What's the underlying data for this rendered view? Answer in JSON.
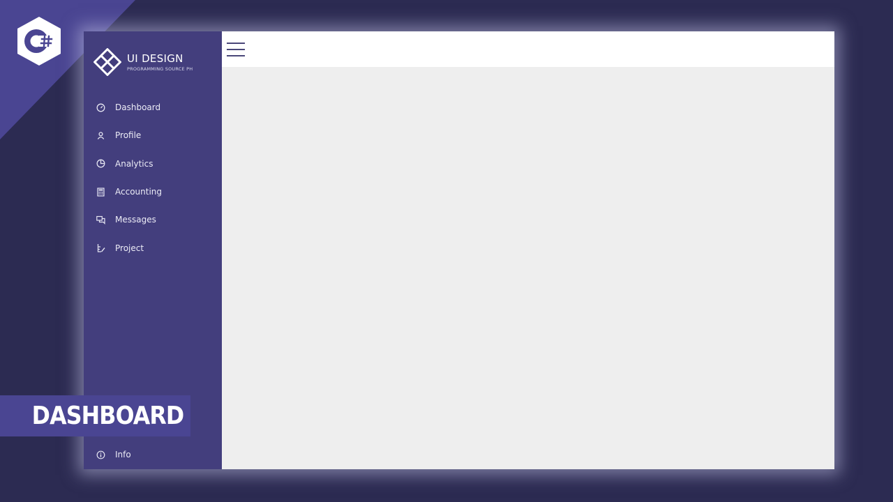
{
  "brand": {
    "title": "UI DESIGN",
    "subtitle": "PROGRAMMING SOURCE PH",
    "logo_icon": "diamond-grid-icon"
  },
  "badge": {
    "text": "C#",
    "icon": "csharp-hexagon-icon"
  },
  "sidebar": {
    "items": [
      {
        "label": "Dashboard",
        "icon": "gauge-icon"
      },
      {
        "label": "Profile",
        "icon": "user-icon"
      },
      {
        "label": "Analytics",
        "icon": "pie-chart-icon"
      },
      {
        "label": "Accounting",
        "icon": "calculator-icon"
      },
      {
        "label": "Messages",
        "icon": "chat-icon"
      },
      {
        "label": "Project",
        "icon": "project-icon"
      }
    ],
    "footer": {
      "label": "Info",
      "icon": "info-icon"
    }
  },
  "topbar": {
    "menu_icon": "hamburger-icon"
  },
  "banner": {
    "text": "DASHBOARD"
  },
  "colors": {
    "background": "#2c2b52",
    "sidebar": "#433e7d",
    "accent": "#4a4592",
    "topbar": "#ffffff",
    "content": "#eeeeee"
  }
}
